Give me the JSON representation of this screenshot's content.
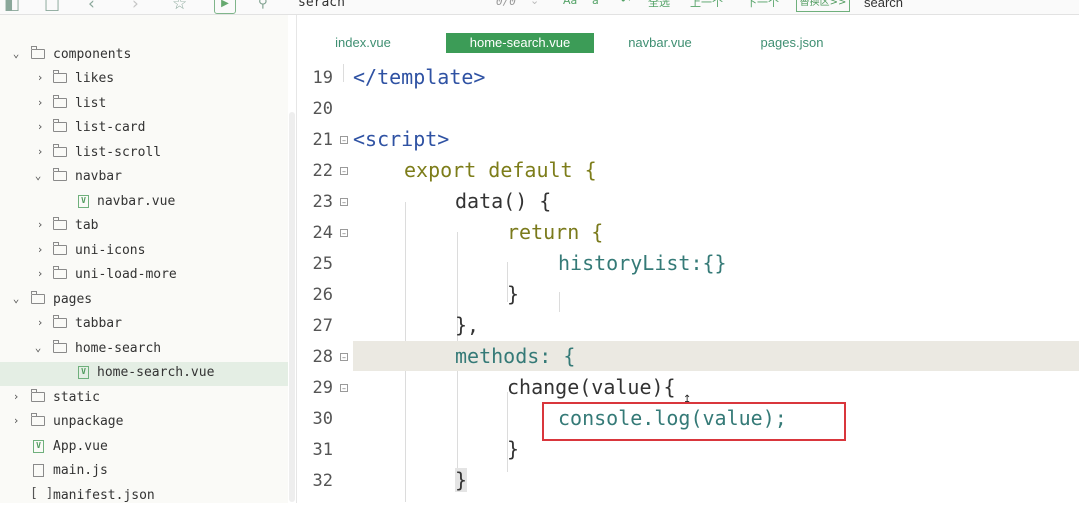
{
  "toolbar": {
    "find_query": "serach",
    "match_count": "0/0",
    "opt_case": "Aa",
    "opt_word": "ã",
    "opt_regex": "•*",
    "select_all": "全选",
    "prev": "上一个",
    "next": "下一个",
    "replace_toggle": "替换区>>",
    "replace_value": "search"
  },
  "sidebar": {
    "items": [
      {
        "label": "components",
        "kind": "folder",
        "expanded": true
      },
      {
        "label": "likes",
        "kind": "folder",
        "expanded": false
      },
      {
        "label": "list",
        "kind": "folder",
        "expanded": false
      },
      {
        "label": "list-card",
        "kind": "folder",
        "expanded": false
      },
      {
        "label": "list-scroll",
        "kind": "folder",
        "expanded": false
      },
      {
        "label": "navbar",
        "kind": "folder",
        "expanded": true
      },
      {
        "label": "navbar.vue",
        "kind": "vue"
      },
      {
        "label": "tab",
        "kind": "folder",
        "expanded": false
      },
      {
        "label": "uni-icons",
        "kind": "folder",
        "expanded": false
      },
      {
        "label": "uni-load-more",
        "kind": "folder",
        "expanded": false
      },
      {
        "label": "pages",
        "kind": "folder",
        "expanded": true
      },
      {
        "label": "tabbar",
        "kind": "folder",
        "expanded": false
      },
      {
        "label": "home-search",
        "kind": "folder",
        "expanded": true
      },
      {
        "label": "home-search.vue",
        "kind": "vue",
        "selected": true
      },
      {
        "label": "static",
        "kind": "folder",
        "expanded": false
      },
      {
        "label": "unpackage",
        "kind": "folder",
        "expanded": false
      },
      {
        "label": "App.vue",
        "kind": "vue"
      },
      {
        "label": "main.js",
        "kind": "js"
      },
      {
        "label": "manifest.json",
        "kind": "json"
      }
    ]
  },
  "tabs": [
    {
      "label": "index.vue",
      "active": false
    },
    {
      "label": "home-search.vue",
      "active": true
    },
    {
      "label": "navbar.vue",
      "active": false
    },
    {
      "label": "pages.json",
      "active": false
    }
  ],
  "editor": {
    "lines": [
      {
        "n": "19",
        "text": "</template>"
      },
      {
        "n": "20",
        "text": ""
      },
      {
        "n": "21",
        "text": "<script>"
      },
      {
        "n": "22",
        "text": "export default {"
      },
      {
        "n": "23",
        "text": "data() {"
      },
      {
        "n": "24",
        "text": "return {"
      },
      {
        "n": "25",
        "text": "historyList:{}"
      },
      {
        "n": "26",
        "text": "}"
      },
      {
        "n": "27",
        "text": "},"
      },
      {
        "n": "28",
        "text": "methods: {"
      },
      {
        "n": "29",
        "text": "change(value){"
      },
      {
        "n": "30",
        "text": "console.log(value);"
      },
      {
        "n": "31",
        "text": "}"
      },
      {
        "n": "32",
        "text": "}"
      }
    ]
  },
  "colors": {
    "accent": "#3c9c57",
    "tag": "#2f52a3",
    "keyword": "#7d7d1a",
    "property": "#357a77",
    "highlight_box": "#d9363c"
  }
}
